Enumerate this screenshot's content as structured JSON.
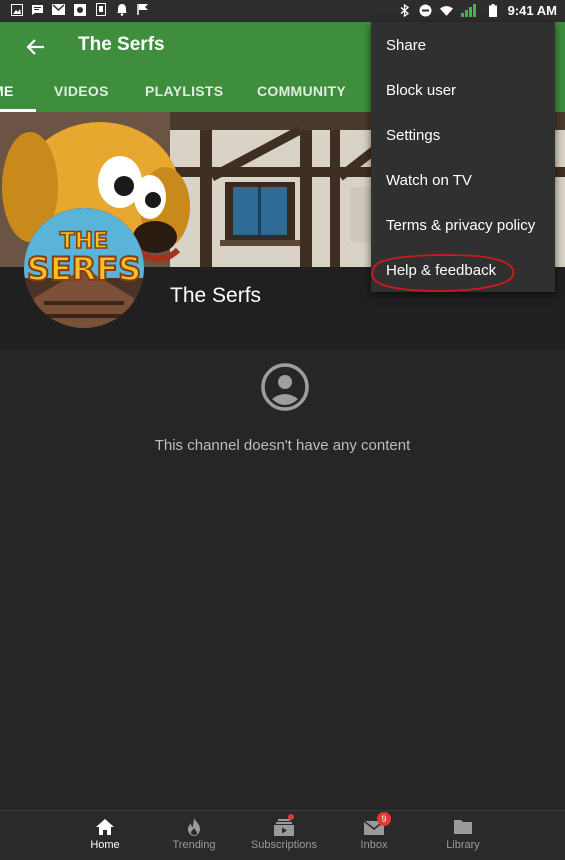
{
  "status_bar": {
    "time": "9:41 AM",
    "left_icons": [
      "image-icon",
      "message-icon",
      "gmail-icon",
      "photo-icon",
      "device-icon",
      "bell-icon",
      "flag-icon"
    ],
    "right_icons": [
      "bluetooth-icon",
      "do-not-disturb-icon",
      "wifi-icon",
      "signal-icon",
      "battery-icon"
    ]
  },
  "app_bar": {
    "title": "The Serfs",
    "tabs": [
      {
        "label": "ME"
      },
      {
        "label": "VIDEOS"
      },
      {
        "label": "PLAYLISTS"
      },
      {
        "label": "COMMUNITY"
      }
    ]
  },
  "channel": {
    "name": "The Serfs",
    "logo_text": "THE SERFS"
  },
  "empty_state": {
    "message": "This channel doesn't have any content"
  },
  "overflow_menu": {
    "items": [
      {
        "label": "Share"
      },
      {
        "label": "Block user"
      },
      {
        "label": "Settings"
      },
      {
        "label": "Watch on TV"
      },
      {
        "label": "Terms & privacy policy"
      },
      {
        "label": "Help & feedback"
      }
    ]
  },
  "bottom_nav": {
    "items": [
      {
        "label": "Home"
      },
      {
        "label": "Trending"
      },
      {
        "label": "Subscriptions"
      },
      {
        "label": "Inbox",
        "badge": "9"
      },
      {
        "label": "Library"
      }
    ]
  },
  "colors": {
    "accent_green": "#3e8e3e",
    "background": "#262626",
    "menu": "#303030",
    "badge_red": "#e53935",
    "annotation_red": "#d0181e"
  }
}
